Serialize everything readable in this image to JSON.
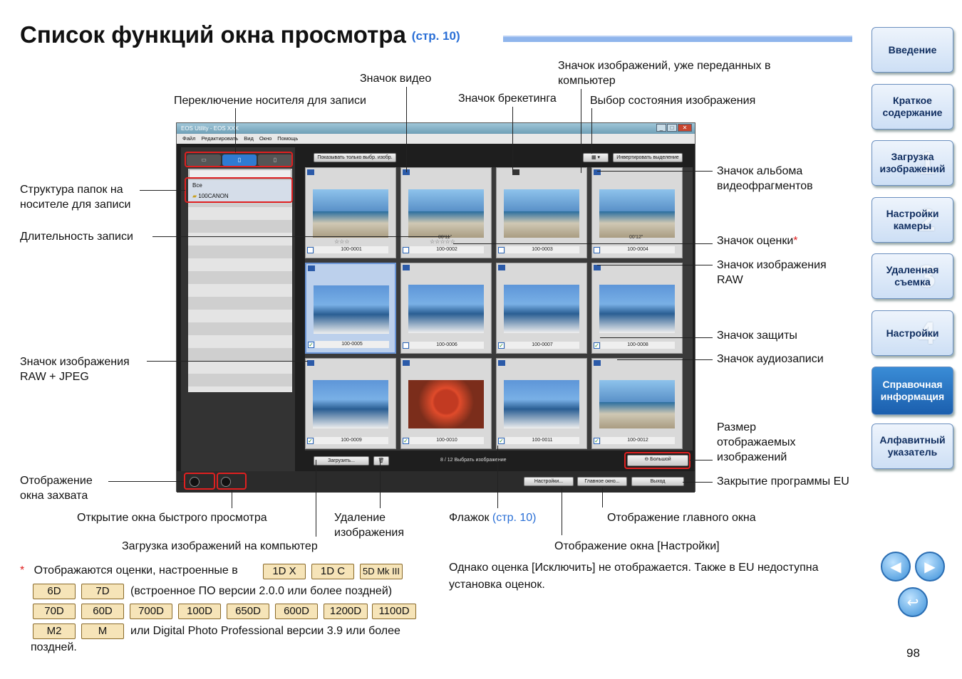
{
  "title": "Список функций окна просмотра",
  "title_ref": "(стр. 10)",
  "sidebar": [
    {
      "label": "Введение",
      "num": ""
    },
    {
      "label": "Краткое содержание",
      "num": ""
    },
    {
      "label": "Загрузка изображений",
      "num": "1"
    },
    {
      "label": "Настройки камеры",
      "num": "2"
    },
    {
      "label": "Удаленная съемка",
      "num": "3"
    },
    {
      "label": "Настройки",
      "num": "4"
    },
    {
      "label": "Справочная информация",
      "num": ""
    },
    {
      "label": "Алфавитный указатель",
      "num": ""
    }
  ],
  "labels": {
    "video_icon": "Значок видео",
    "transferred_icon": "Значок изображений, уже переданных в компьютер",
    "media_switch": "Переключение носителя для записи",
    "bracketing_icon": "Значок брекетинга",
    "image_state": "Выбор состояния изображения",
    "album_icon": "Значок альбома видеофрагментов",
    "folder_structure": "Структура папок на носителе для записи",
    "record_length": "Длительность записи",
    "rating_icon": "Значок оценки",
    "raw_icon": "Значок изображения RAW",
    "protect_icon": "Значок защиты",
    "raw_jpeg_icon": "Значок изображения RAW + JPEG",
    "audio_icon": "Значок аудиозаписи",
    "display_size": "Размер отображаемых изображений",
    "capture_window": "Отображение окна захвата",
    "close_eu": "Закрытие программы EU",
    "quick_preview": "Открытие окна быстрого просмотра",
    "delete_image": "Удаление изображения",
    "flag": "Флажок",
    "flag_ref": "(стр. 10)",
    "main_window": "Отображение главного окна",
    "download": "Загрузка изображений на компьютер",
    "settings_window": "Отображение окна [Настройки]"
  },
  "window": {
    "title": "EOS Utility - EOS XXX",
    "menu": [
      "Файл",
      "Редактировать",
      "Вид",
      "Окно",
      "Помощь"
    ],
    "show_selected": "Показывать только выбр. изобр.",
    "invert": "Инвертировать выделение",
    "folder_all": "Все",
    "folder_name": "100CANON",
    "download_btn": "Загрузить...",
    "status": "8 / 12 Выбрать изображение",
    "size_label": "Большой",
    "settings_btn": "Настройки...",
    "main_btn": "Главное окно...",
    "exit_btn": "Выход",
    "thumbs": [
      {
        "name": "100-0001",
        "extra": "☆☆☆"
      },
      {
        "name": "100-0002",
        "extra": "00'11\""
      },
      {
        "name": "100-0003",
        "extra": ""
      },
      {
        "name": "100-0004",
        "extra": "00'12\""
      },
      {
        "name": "100-0005",
        "extra": ""
      },
      {
        "name": "100-0006",
        "extra": ""
      },
      {
        "name": "100-0007",
        "extra": ""
      },
      {
        "name": "100-0008",
        "extra": ""
      },
      {
        "name": "100-0009",
        "extra": ""
      },
      {
        "name": "100-0010",
        "extra": ""
      },
      {
        "name": "100-0011",
        "extra": ""
      },
      {
        "name": "100-0012",
        "extra": ""
      }
    ]
  },
  "footnote": {
    "star": "*",
    "lead": "Отображаются оценки, настроенные в",
    "row2": "(встроенное ПО версии 2.0.0 или более поздней)",
    "row4": "или Digital Photo Professional версии 3.9 или более",
    "row5": "поздней.",
    "cams1": [
      "1D X",
      "1D C",
      "5D Mk III"
    ],
    "cams2": [
      "6D",
      "7D"
    ],
    "cams3": [
      "70D",
      "60D",
      "700D",
      "100D",
      "650D",
      "600D",
      "1200D",
      "1100D"
    ],
    "cams4": [
      "M2",
      "M"
    ]
  },
  "note_right": "Однако оценка [Исключить] не отображается. Также в EU недоступна установка оценок.",
  "page_number": "98"
}
